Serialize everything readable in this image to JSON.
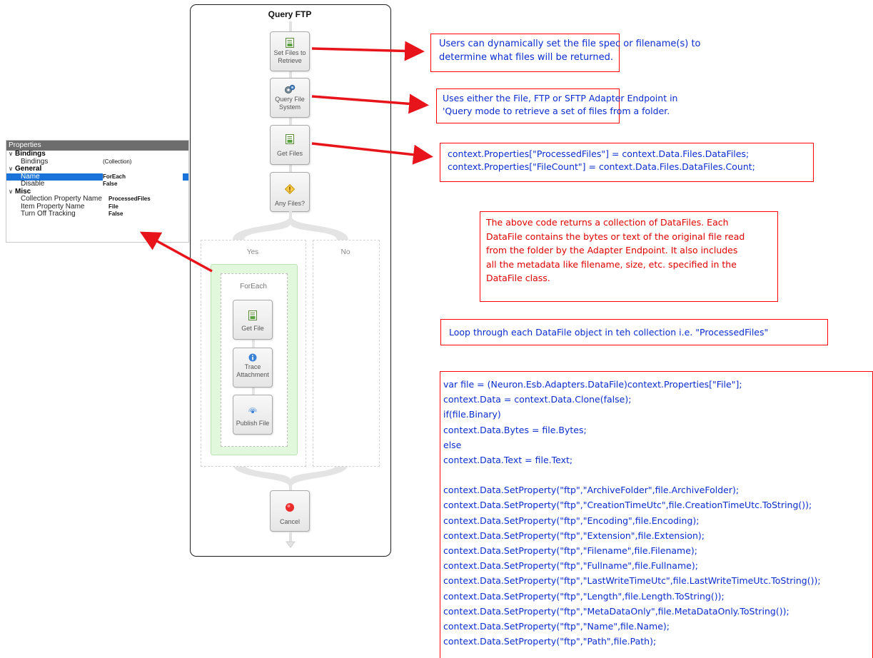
{
  "properties": {
    "header": "Properties",
    "categories": [
      {
        "name": "Bindings",
        "rows": [
          {
            "name": "Bindings",
            "value": "(Collection)"
          }
        ]
      },
      {
        "name": "General",
        "rows": [
          {
            "name": "Name",
            "value": "ForEach",
            "selected": true
          },
          {
            "name": "Disable",
            "value": "False"
          }
        ]
      },
      {
        "name": "Misc",
        "rows": [
          {
            "name": "Collection Property Name",
            "value": "ProcessedFiles"
          },
          {
            "name": "Item Property Name",
            "value": "File"
          },
          {
            "name": "Turn Off Tracking",
            "value": "False"
          }
        ]
      }
    ]
  },
  "workflow": {
    "title": "Query FTP",
    "steps": {
      "set_files": "Set Files to Retrieve",
      "query_fs": "Query File System",
      "get_files": "Get Files",
      "any_files": "Any Files?",
      "cancel": "Cancel"
    },
    "branches": {
      "yes": "Yes",
      "no": "No"
    },
    "foreach": {
      "label": "ForEach",
      "steps": {
        "get_file": "Get File",
        "trace": "Trace Attachment",
        "publish": "Publish File"
      }
    }
  },
  "callouts": {
    "c1": [
      "Users can dynamically set the file spec or filename(s) to",
      "determine what files will be returned."
    ],
    "c2": [
      "Uses either the File, FTP or SFTP Adapter Endpoint in",
      "'Query mode to retrieve a set of files from a folder."
    ],
    "c3": [
      "context.Properties[\"ProcessedFiles\"] = context.Data.Files.DataFiles;",
      "context.Properties[\"FileCount\"] = context.Data.Files.DataFiles.Count;"
    ],
    "c4": [
      "The above code returns a collection of DataFiles. Each",
      "DataFile contains the bytes or text of the original file read",
      "from the folder by the Adapter Endpoint. It also includes",
      "all the metadata like filename, size, etc. specified in the",
      "DataFile class."
    ],
    "c5": [
      "Loop through each DataFile object in teh collection i.e. \"ProcessedFiles\""
    ],
    "c6": [
      "var file = (Neuron.Esb.Adapters.DataFile)context.Properties[\"File\"];",
      "context.Data = context.Data.Clone(false);",
      "if(file.Binary)",
      "context.Data.Bytes = file.Bytes;",
      "else",
      "context.Data.Text = file.Text;",
      "",
      "context.Data.SetProperty(\"ftp\",\"ArchiveFolder\",file.ArchiveFolder);",
      "context.Data.SetProperty(\"ftp\",\"CreationTimeUtc\",file.CreationTimeUtc.ToString());",
      "context.Data.SetProperty(\"ftp\",\"Encoding\",file.Encoding);",
      "context.Data.SetProperty(\"ftp\",\"Extension\",file.Extension);",
      "context.Data.SetProperty(\"ftp\",\"Filename\",file.Filename);",
      "context.Data.SetProperty(\"ftp\",\"Fullname\",file.Fullname);",
      "context.Data.SetProperty(\"ftp\",\"LastWriteTimeUtc\",file.LastWriteTimeUtc.ToString());",
      "context.Data.SetProperty(\"ftp\",\"Length\",file.Length.ToString());",
      "context.Data.SetProperty(\"ftp\",\"MetaDataOnly\",file.MetaDataOnly.ToString());",
      "context.Data.SetProperty(\"ftp\",\"Name\",file.Name);",
      "context.Data.SetProperty(\"ftp\",\"Path\",file.Path);"
    ]
  },
  "colors": {
    "arrow": "#e8141b",
    "callout_border": "#ff0000",
    "code_text": "#0b2ccf",
    "note_text": "#e00000",
    "selection": "#1a73d9"
  }
}
